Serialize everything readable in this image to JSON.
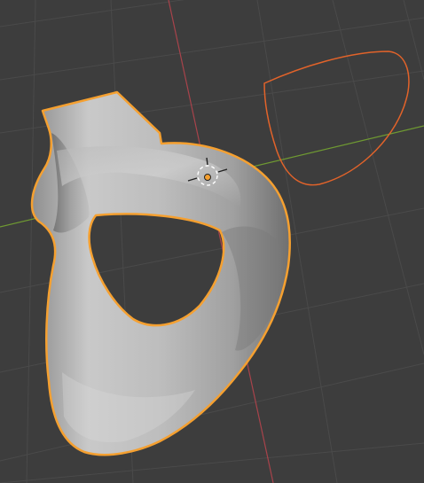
{
  "viewport": {
    "background": "#3d3d3d",
    "grid_color": "#4a4a4a",
    "x_axis_color": "#a8434b",
    "y_axis_color": "#6f9a32",
    "selection_color": "#f5a030",
    "curve_color": "#e2632a",
    "origin_color": "#f5a030"
  },
  "objects": {
    "active_object_icon": "mesh-object",
    "curve_object_icon": "curve-object",
    "origin_icon": "object-origin",
    "cursor_icon": "3d-cursor"
  }
}
